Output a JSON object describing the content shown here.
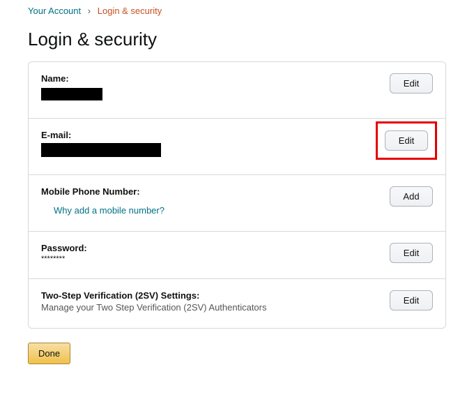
{
  "breadcrumb": {
    "root": "Your Account",
    "sep": "›",
    "current": "Login & security"
  },
  "page_title": "Login & security",
  "rows": {
    "name": {
      "label": "Name:",
      "button": "Edit"
    },
    "email": {
      "label": "E-mail:",
      "button": "Edit"
    },
    "mobile": {
      "label": "Mobile Phone Number:",
      "link": "Why add a mobile number?",
      "button": "Add"
    },
    "password": {
      "label": "Password:",
      "value": "********",
      "button": "Edit"
    },
    "twostep": {
      "label": "Two-Step Verification (2SV) Settings:",
      "desc": "Manage your Two Step Verification (2SV) Authenticators",
      "button": "Edit"
    }
  },
  "done_label": "Done"
}
